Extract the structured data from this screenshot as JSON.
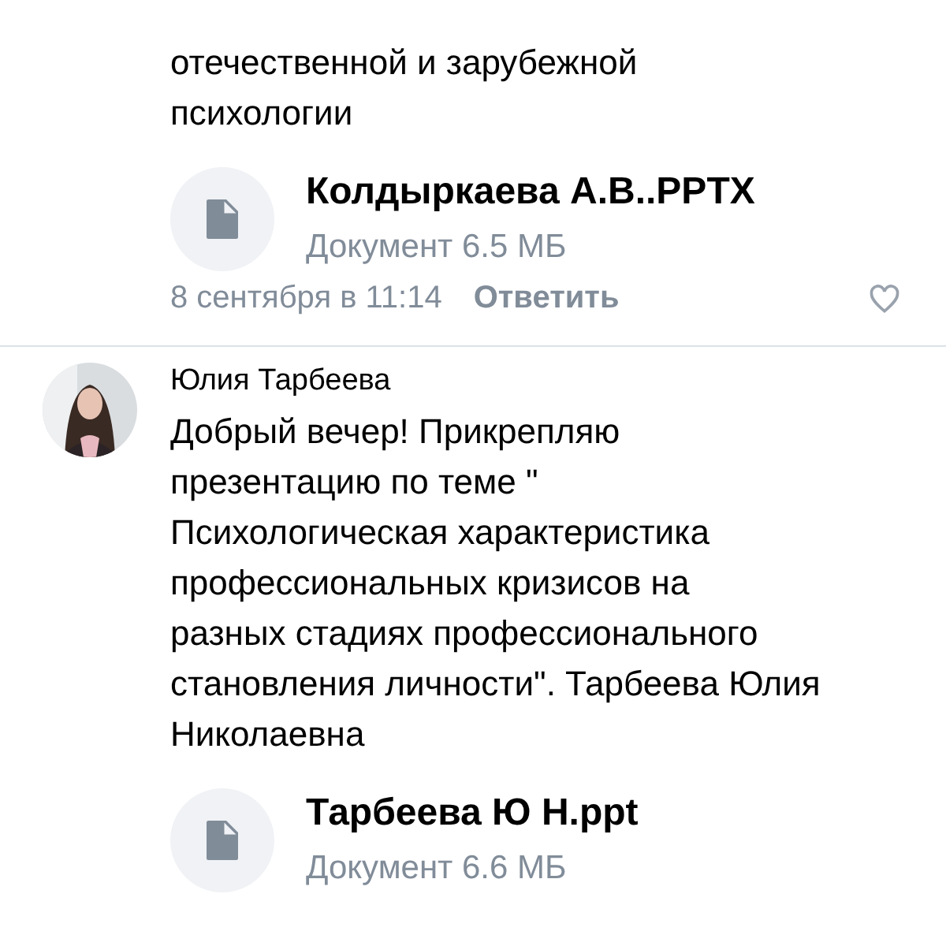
{
  "comments": [
    {
      "text": "отечественной и зарубежной\nпсихологии",
      "attachment": {
        "name": "Колдыркаева А.В..PPTX",
        "info": "Документ 6.5 МБ"
      },
      "date": "8 сентября в 11:14",
      "reply": "Ответить"
    },
    {
      "author": "Юлия Тарбеева",
      "text": "Добрый вечер! Прикрепляю\nпрезентацию по теме \"\nПсихологическая характеристика\nпрофессиональных кризисов на\nразных стадиях профессионального\nстановления личности\". Тарбеева Юлия\nНиколаевна",
      "attachment": {
        "name": "Тарбеева Ю Н.ppt",
        "info": "Документ 6.6 МБ"
      }
    }
  ]
}
